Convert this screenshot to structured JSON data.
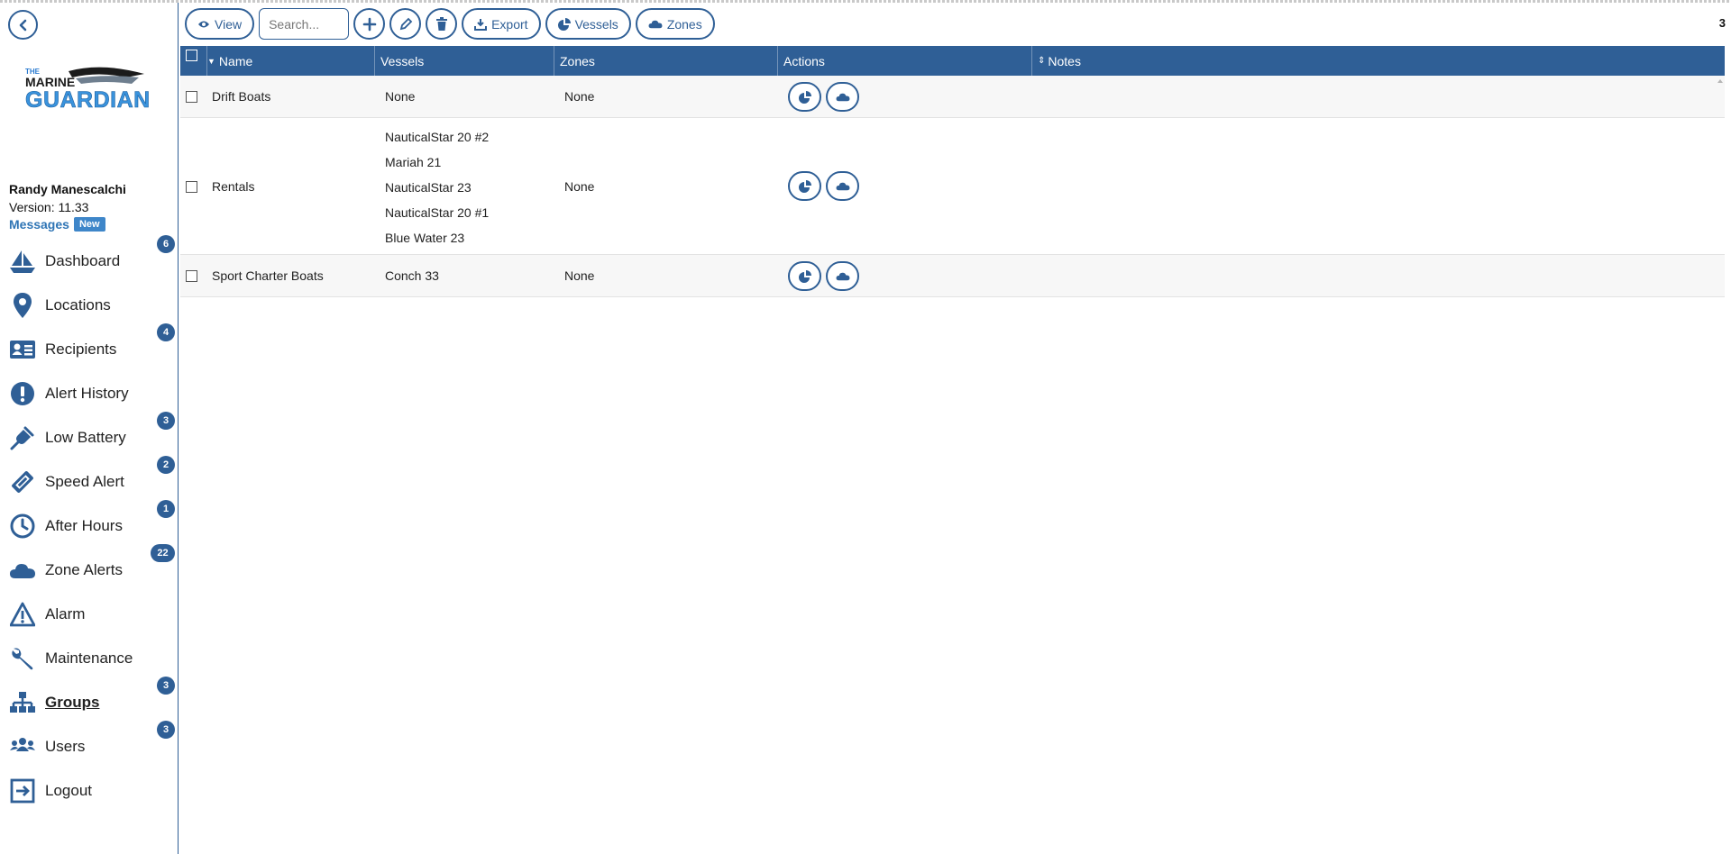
{
  "sidebar": {
    "logo_text": "THE MARINE GUARDIAN",
    "user_name": "Randy Manescalchi",
    "version": "Version: 11.33",
    "messages_label": "Messages",
    "messages_badge": "New",
    "items": [
      {
        "label": "Dashboard",
        "icon": "sailboat-icon",
        "badge": "6"
      },
      {
        "label": "Locations",
        "icon": "map-pin-icon",
        "badge": ""
      },
      {
        "label": "Recipients",
        "icon": "contact-card-icon",
        "badge": "4"
      },
      {
        "label": "Alert History",
        "icon": "exclamation-icon",
        "badge": ""
      },
      {
        "label": "Low Battery",
        "icon": "plug-icon",
        "badge": "3"
      },
      {
        "label": "Speed Alert",
        "icon": "ticket-icon",
        "badge": "2"
      },
      {
        "label": "After Hours",
        "icon": "clock-icon",
        "badge": "1"
      },
      {
        "label": "Zone Alerts",
        "icon": "cloud-icon",
        "badge": "22"
      },
      {
        "label": "Alarm",
        "icon": "warning-icon",
        "badge": ""
      },
      {
        "label": "Maintenance",
        "icon": "wrench-icon",
        "badge": ""
      },
      {
        "label": "Groups",
        "icon": "sitemap-icon",
        "badge": "3",
        "active": true
      },
      {
        "label": "Users",
        "icon": "users-icon",
        "badge": "3"
      },
      {
        "label": "Logout",
        "icon": "logout-icon",
        "badge": ""
      }
    ]
  },
  "toolbar": {
    "view_label": "View",
    "search_placeholder": "Search...",
    "export_label": "Export",
    "vessels_label": "Vessels",
    "zones_label": "Zones",
    "record_count": "3"
  },
  "table": {
    "columns": [
      "Name",
      "Vessels",
      "Zones",
      "Actions",
      "Notes"
    ],
    "rows": [
      {
        "name": "Drift Boats",
        "vessels": [
          "None"
        ],
        "zones": "None",
        "notes": ""
      },
      {
        "name": "Rentals",
        "vessels": [
          "NauticalStar 20 #2",
          "Mariah 21",
          "NauticalStar 23",
          "NauticalStar 20 #1",
          "Blue Water 23"
        ],
        "zones": "None",
        "notes": ""
      },
      {
        "name": "Sport Charter Boats",
        "vessels": [
          "Conch 33"
        ],
        "zones": "None",
        "notes": ""
      }
    ]
  },
  "colors": {
    "primary": "#2f5f96",
    "link": "#2f75b5",
    "badge_new": "#3e86c9"
  }
}
